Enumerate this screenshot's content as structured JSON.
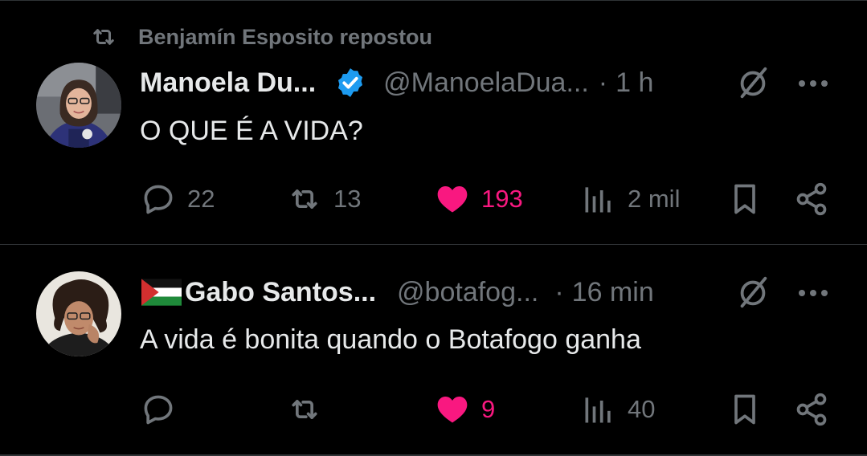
{
  "repost_banner": {
    "text": "Benjamín Esposito repostou"
  },
  "posts": [
    {
      "display_name": "Manoela Du...",
      "verified": true,
      "handle": "@ManoelaDua...",
      "separator": "·",
      "time": "1 h",
      "text": "O QUE É A VIDA?",
      "replies": "22",
      "reposts": "13",
      "likes": "193",
      "views": "2 mil"
    },
    {
      "display_name": "Gabo Santos...",
      "flag": "palestine-flag",
      "handle": "@botafog...",
      "separator": "·",
      "time": "16 min",
      "text": "A vida é bonita quando o Botafogo ganha",
      "replies": "",
      "reposts": "",
      "likes": "9",
      "views": "40"
    }
  ],
  "colors": {
    "background": "#000000",
    "primary_text": "#e7e9ea",
    "secondary_text": "#71767b",
    "like_pink": "#f91880",
    "verified_blue": "#1d9bf0",
    "divider": "#2f3336"
  },
  "icons": [
    "repost-icon",
    "verified-badge-icon",
    "grok-icon",
    "more-icon",
    "reply-icon",
    "heart-icon",
    "views-icon",
    "bookmark-icon",
    "share-icon"
  ]
}
